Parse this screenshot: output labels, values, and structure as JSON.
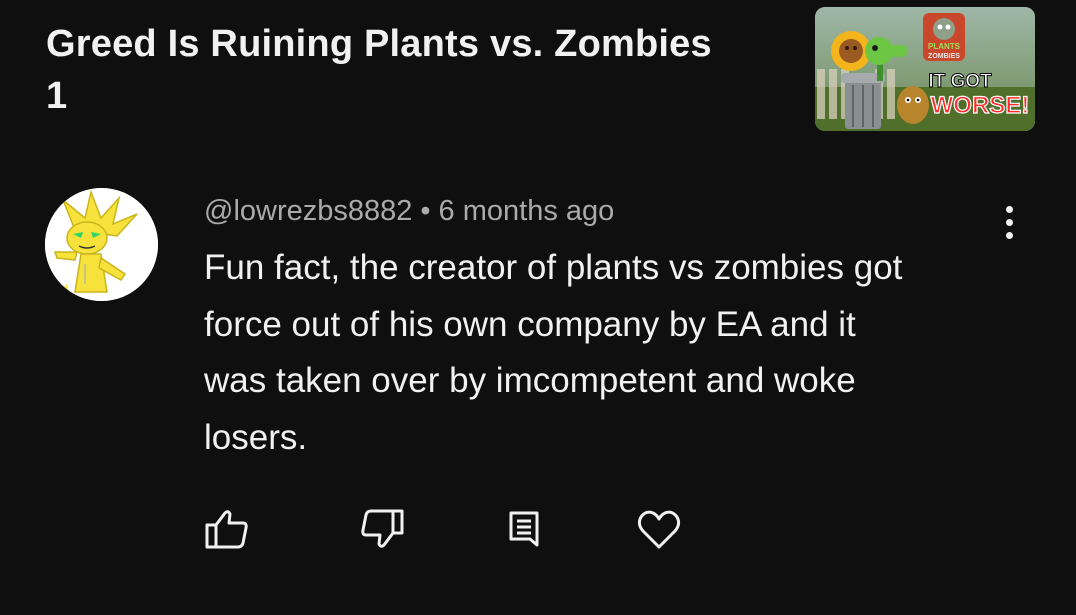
{
  "video": {
    "title_line1": "Greed Is Ruining Plants vs. Zombies",
    "title_line2": "1",
    "thumbnail": {
      "logo_text_1": "PLANTS",
      "logo_text_2": "ZOMBIES",
      "caption_1": "IT GOT",
      "caption_2": "WORSE!"
    }
  },
  "comment": {
    "author": "@lowrezbs8882",
    "separator": "•",
    "time": "6 months ago",
    "text_lines": [
      "Fun fact, the creator of plants vs zombies got",
      "force out of his own company by EA and it",
      "was taken over by imcompetent and woke",
      "losers."
    ]
  },
  "actions": [
    {
      "icon": "thumbs-up-icon"
    },
    {
      "icon": "thumbs-down-icon"
    },
    {
      "icon": "reply-icon"
    },
    {
      "icon": "heart-icon"
    }
  ],
  "colors": {
    "background": "#0f0f0f",
    "text_primary": "#f1f1f1",
    "text_secondary": "#aaaaaa"
  }
}
